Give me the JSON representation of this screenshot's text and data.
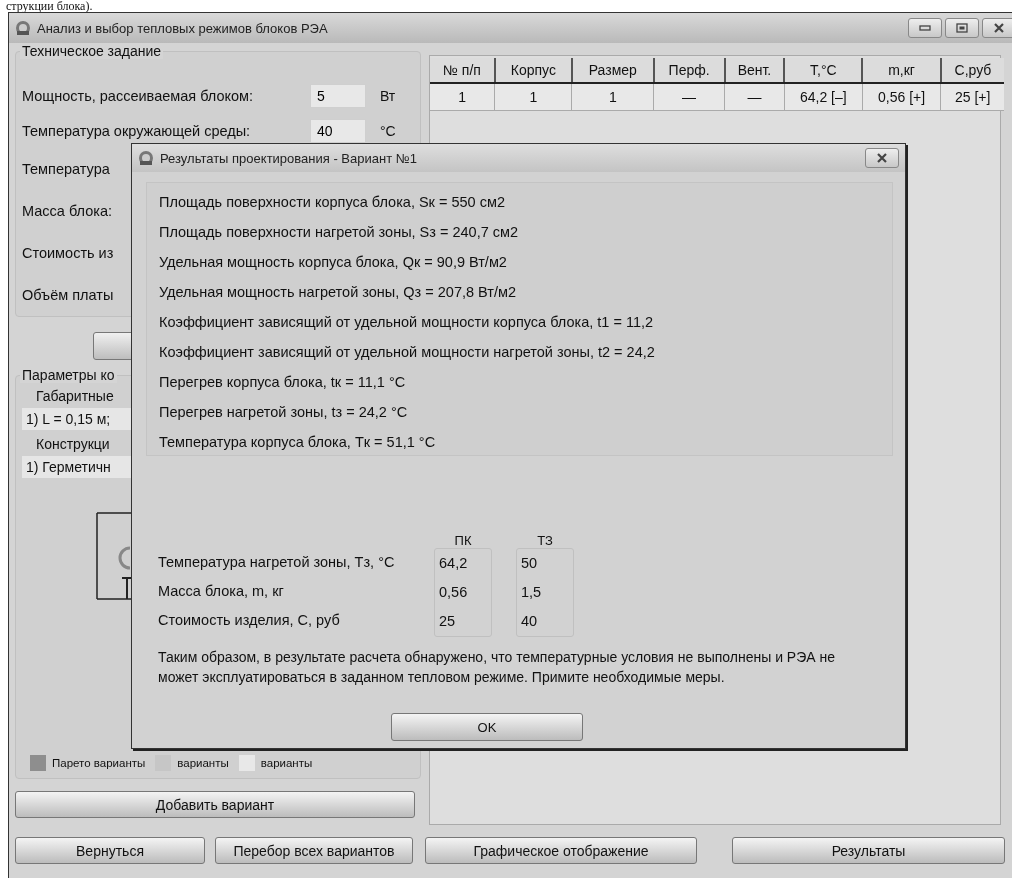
{
  "document_text": "струкции блока).",
  "window": {
    "title": "Анализ и выбор тепловых режимов блоков РЭА"
  },
  "spec_group": {
    "title": "Техническое задание",
    "rows": [
      {
        "label": "Мощность, рассеиваемая блоком:",
        "value": "5",
        "unit": "Вт"
      },
      {
        "label": "Температура окружающей среды:",
        "value": "40",
        "unit": "°C"
      },
      {
        "label": "Температура"
      },
      {
        "label": "Масса блока:"
      },
      {
        "label": "Стоимость из"
      },
      {
        "label": "Объём платы"
      }
    ]
  },
  "params_group": {
    "title": "Параметры ко",
    "size_label": "Габаритные",
    "size_value": "1) L = 0,15 м;",
    "design_label": "Конструкци",
    "design_value": "1) Герметичн"
  },
  "legend": [
    {
      "label": "Парето варианты",
      "color": "#8e8e8e"
    },
    {
      "label": "варианты",
      "color": "#c6c6c6"
    },
    {
      "label": "варианты",
      "color": "#e8e8e8"
    }
  ],
  "add_button": "Добавить вариант",
  "table": {
    "columns": [
      "№ п/п",
      "Корпус",
      "Размер",
      "Перф.",
      "Вент.",
      "T,°C",
      "m,кг",
      "C,руб"
    ],
    "rows": [
      {
        "cells": [
          "1",
          "1",
          "1",
          "—",
          "—",
          "64,2 [–]",
          "0,56 [+]",
          "25 [+]"
        ]
      }
    ]
  },
  "bottom_buttons": [
    "Вернуться",
    "Перебор всех вариантов",
    "Графическое отображение",
    "Результаты"
  ],
  "dialog": {
    "title": "Результаты проектирования - Вариант №1",
    "lines": [
      "Площадь поверхности корпуса блока, Sк = 550 см2",
      "Площадь поверхности нагретой зоны, Sз = 240,7 см2",
      "Удельная мощность корпуса блока, Qк = 90,9 Вт/м2",
      "Удельная мощность нагретой зоны, Qз = 207,8 Вт/м2",
      "Коэффициент зависящий от удельной мощности корпуса блока, t1 = 11,2",
      "Коэффициент зависящий от удельной мощности нагретой зоны, t2 = 24,2",
      "Перегрев корпуса блока, tк = 11,1 °C",
      "Перегрев нагретой зоны, tз = 24,2 °C",
      "Температура корпуса блока, Tк = 51,1 °C"
    ],
    "comparison": {
      "columns": [
        "ПК",
        "ТЗ"
      ],
      "rows": [
        {
          "label": "Температура нагретой зоны, Tз, °C",
          "values": [
            "64,2",
            "50"
          ]
        },
        {
          "label": "Масса блока, m, кг",
          "values": [
            "0,56",
            "1,5"
          ]
        },
        {
          "label": "Стоимость изделия, C, руб",
          "values": [
            "25",
            "40"
          ]
        }
      ]
    },
    "conclusion": "Таким образом, в результате расчета обнаружено, что температурные условия не выполнены и РЭА не может эксплуатироваться в заданном тепловом режиме. Примите необходимые меры.",
    "ok_button": "OK"
  }
}
